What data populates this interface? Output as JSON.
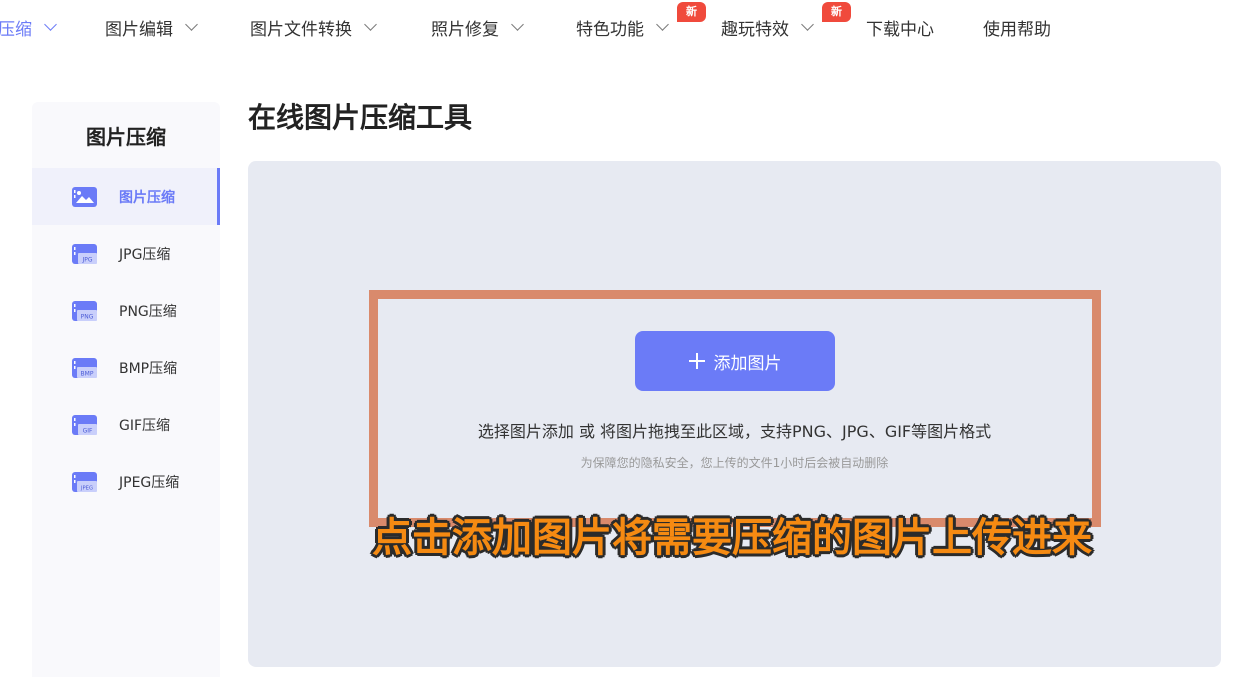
{
  "nav": {
    "items": [
      {
        "label": "压缩",
        "chevron": true,
        "active": true
      },
      {
        "label": "图片编辑",
        "chevron": true
      },
      {
        "label": "图片文件转换",
        "chevron": true
      },
      {
        "label": "照片修复",
        "chevron": true
      },
      {
        "label": "特色功能",
        "chevron": true,
        "badge": "新"
      },
      {
        "label": "趣玩特效",
        "chevron": true,
        "badge": "新"
      },
      {
        "label": "下载中心",
        "chevron": false
      },
      {
        "label": "使用帮助",
        "chevron": false
      }
    ]
  },
  "sidebar": {
    "title": "图片压缩",
    "items": [
      {
        "label": "图片压缩",
        "icon": "image-icon",
        "active": true
      },
      {
        "label": "JPG压缩",
        "icon": "jpg-file-icon",
        "tag": "JPG"
      },
      {
        "label": "PNG压缩",
        "icon": "png-file-icon",
        "tag": "PNG"
      },
      {
        "label": "BMP压缩",
        "icon": "bmp-file-icon",
        "tag": "BMP"
      },
      {
        "label": "GIF压缩",
        "icon": "gif-file-icon",
        "tag": "GIF"
      },
      {
        "label": "JPEG压缩",
        "icon": "jpeg-file-icon",
        "tag": "JPEG"
      }
    ]
  },
  "main": {
    "title": "在线图片压缩工具",
    "add_button": "添加图片",
    "hint": "选择图片添加 或 将图片拖拽至此区域，支持PNG、JPG、GIF等图片格式",
    "privacy": "为保障您的隐私安全，您上传的文件1小时后会被自动删除",
    "overlay_caption": "点击添加图片将需要压缩的图片上传进来"
  },
  "colors": {
    "accent": "#6b7bf7",
    "badge": "#f04a3c",
    "highlight_border": "#d98a6c",
    "caption": "#f58a12",
    "dropzone_bg": "#e7eaf2"
  }
}
